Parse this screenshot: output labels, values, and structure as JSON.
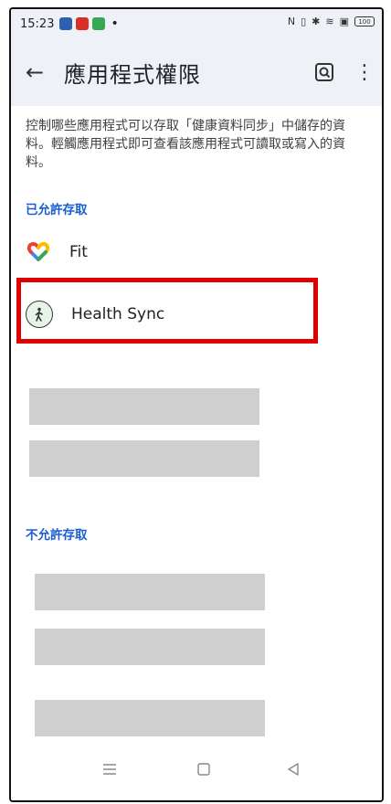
{
  "status": {
    "time": "15:23",
    "battery": "100"
  },
  "appbar": {
    "back_icon": "arrow-back-icon",
    "title": "應用程式權限",
    "search_icon": "app-search-icon",
    "more_icon": "more-vert-icon"
  },
  "description": "控制哪些應用程式可以存取「健康資料同步」中儲存的資料。輕觸應用程式即可查看該應用程式可讀取或寫入的資料。",
  "sections": {
    "allowed_title": "已允許存取",
    "denied_title": "不允許存取"
  },
  "allowed_apps": [
    {
      "label": "Fit",
      "icon": "fit-heart-icon"
    },
    {
      "label": "Health Sync",
      "icon": "health-sync-icon"
    }
  ],
  "colors": {
    "accent": "#1a5fd0",
    "highlight": "#e00000",
    "appbar_bg": "#eef1f6"
  }
}
